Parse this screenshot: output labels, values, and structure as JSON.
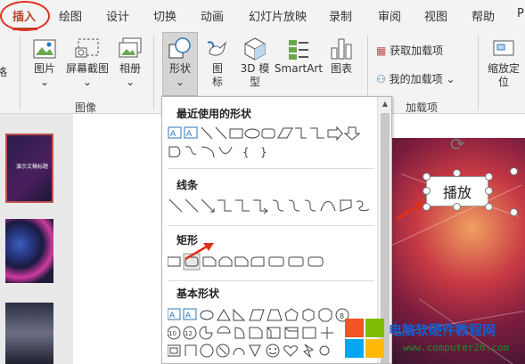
{
  "tabs": [
    "插入",
    "绘图",
    "设计",
    "切换",
    "动画",
    "幻灯片放映",
    "录制",
    "审阅",
    "视图",
    "帮助",
    "P"
  ],
  "active_tab": "插入",
  "ribbon": {
    "left_cut_label": "格",
    "image_group": {
      "picture": "图片",
      "screenshot": "屏幕截图",
      "album": "相册",
      "group_label": "图像"
    },
    "illustrations": {
      "shapes": "形状",
      "icons_line1": "图",
      "icons_line2": "标",
      "model_line1": "3D 模",
      "model_line2": "型",
      "smartart": "SmartArt",
      "chart": "图表"
    },
    "addins": {
      "get": "获取加载项",
      "mine": "我的加载项",
      "group_label": "加载项"
    },
    "zoom_line1": "缩放定",
    "zoom_line2": "位"
  },
  "slide_panel": {
    "thumb1_title": "演示文稿标题"
  },
  "shapes_menu": {
    "recent": "最近使用的形状",
    "lines": "线条",
    "rectangles": "矩形",
    "basic": "基本形状"
  },
  "canvas": {
    "button_text": "播放"
  },
  "watermark": {
    "title": "电脑软硬件教程网",
    "url": "www.computer26.com"
  },
  "colors": {
    "accent": "#b7472a",
    "annotation_red": "#e0301e",
    "shape_blue": "#2e75b6"
  }
}
